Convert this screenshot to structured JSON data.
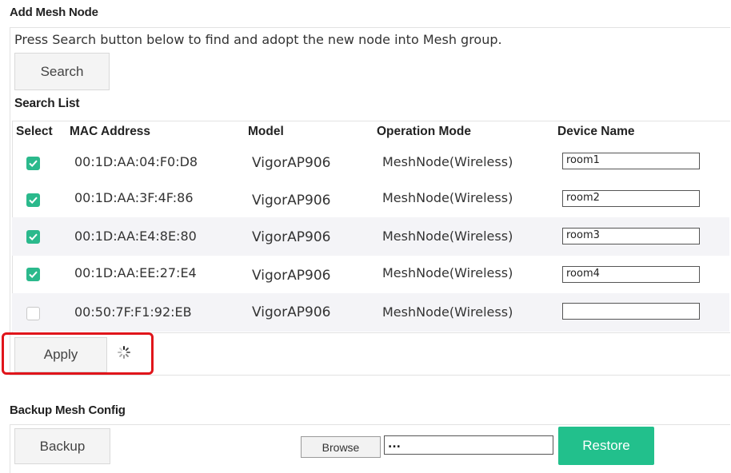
{
  "add_mesh": {
    "title": "Add Mesh Node",
    "instruction": "Press Search button below to find and adopt the new node into Mesh group.",
    "search_label": "Search",
    "search_list_title": "Search List"
  },
  "table": {
    "headers": {
      "select": "Select",
      "mac": "MAC Address",
      "model": "Model",
      "mode": "Operation Mode",
      "device": "Device Name"
    },
    "rows": [
      {
        "checked": true,
        "mac": "00:1D:AA:04:F0:D8",
        "model": "VigorAP906",
        "mode": "MeshNode(Wireless)",
        "device": "room1"
      },
      {
        "checked": true,
        "mac": "00:1D:AA:3F:4F:86",
        "model": "VigorAP906",
        "mode": "MeshNode(Wireless)",
        "device": "room2"
      },
      {
        "checked": true,
        "mac": "00:1D:AA:E4:8E:80",
        "model": "VigorAP906",
        "mode": "MeshNode(Wireless)",
        "device": "room3"
      },
      {
        "checked": true,
        "mac": "00:1D:AA:EE:27:E4",
        "model": "VigorAP906",
        "mode": "MeshNode(Wireless)",
        "device": "room4"
      },
      {
        "checked": false,
        "mac": "00:50:7F:F1:92:EB",
        "model": "VigorAP906",
        "mode": "MeshNode(Wireless)",
        "device": ""
      }
    ]
  },
  "apply_label": "Apply",
  "loading_icon": "spinner-icon",
  "highlight_color": "#e0151b",
  "accent_color": "#2bb98c",
  "backup": {
    "title": "Backup Mesh Config",
    "backup_label": "Backup",
    "browse_label": "Browse",
    "file_value": "...",
    "restore_label": "Restore"
  }
}
